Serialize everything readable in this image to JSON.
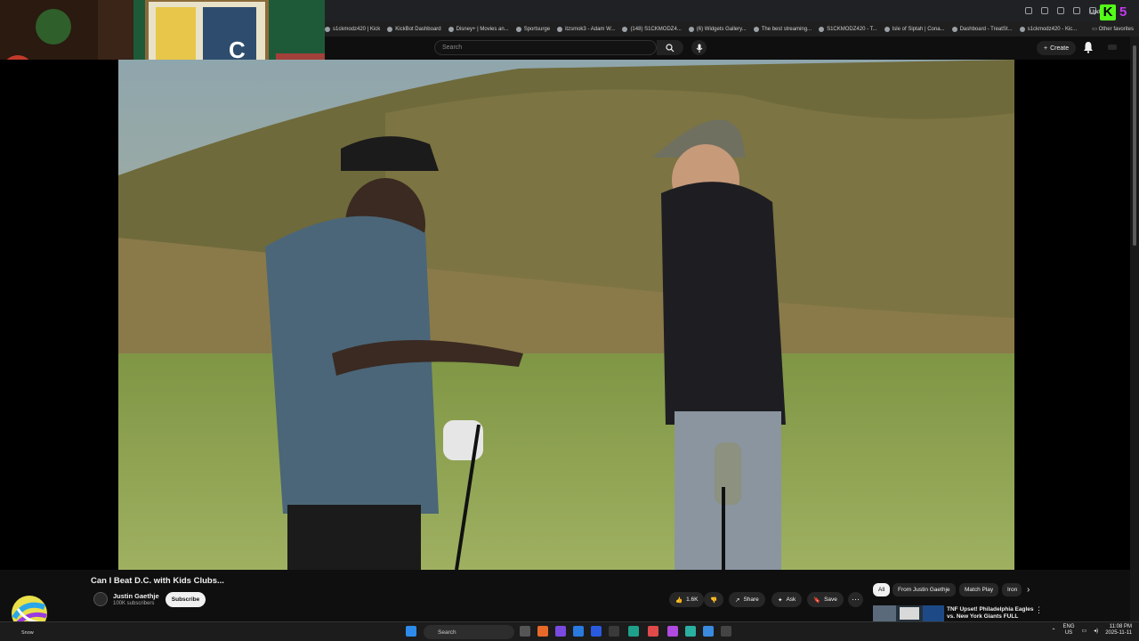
{
  "browser": {
    "update_label": "Upd",
    "bookmarks": [
      "s1ckmodz420 | Kick",
      "KickBot Dashboard",
      "Disney+ | Movies an...",
      "Sportsurge",
      "itzsmok3 - Adam W...",
      "(148) S1CKMODZ4...",
      "(6) Widgets Gallery...",
      "The best streaming...",
      "S1CKMODZ420 - T...",
      "Isle of Siptah | Cona...",
      "Dashboard - TreatSt...",
      "s1ckmodz420 - Kic..."
    ],
    "other_favorites": "Other favorites",
    "logo_text": "K",
    "logo_text_2": "5"
  },
  "youtube": {
    "search_placeholder": "Search",
    "create_label": "Create",
    "video_title": "Can I Beat D.C. with Kids Clubs...",
    "channel_name": "Justin Gaethje",
    "channel_subs": "100K subscribers",
    "subscribe_label": "Subscribe",
    "like_count": "1.6K",
    "share_label": "Share",
    "ask_label": "Ask",
    "save_label": "Save",
    "chips": [
      "All",
      "From Justin Gaethje",
      "Match Play",
      "Iron"
    ],
    "recommended_title": "TNF Upset! Philadelphia Eagles vs. New York Giants FULL"
  },
  "taskbar": {
    "search_label": "Search",
    "lang_top": "ENG",
    "lang_bottom": "US",
    "time": "11:08 PM",
    "date": "2025-11-11",
    "weather_label": "Snow"
  },
  "colors": {
    "accent_kick": "#53fc18",
    "youtube_bg": "#0f0f0f",
    "subscribe_bg": "#f1f1f1"
  }
}
